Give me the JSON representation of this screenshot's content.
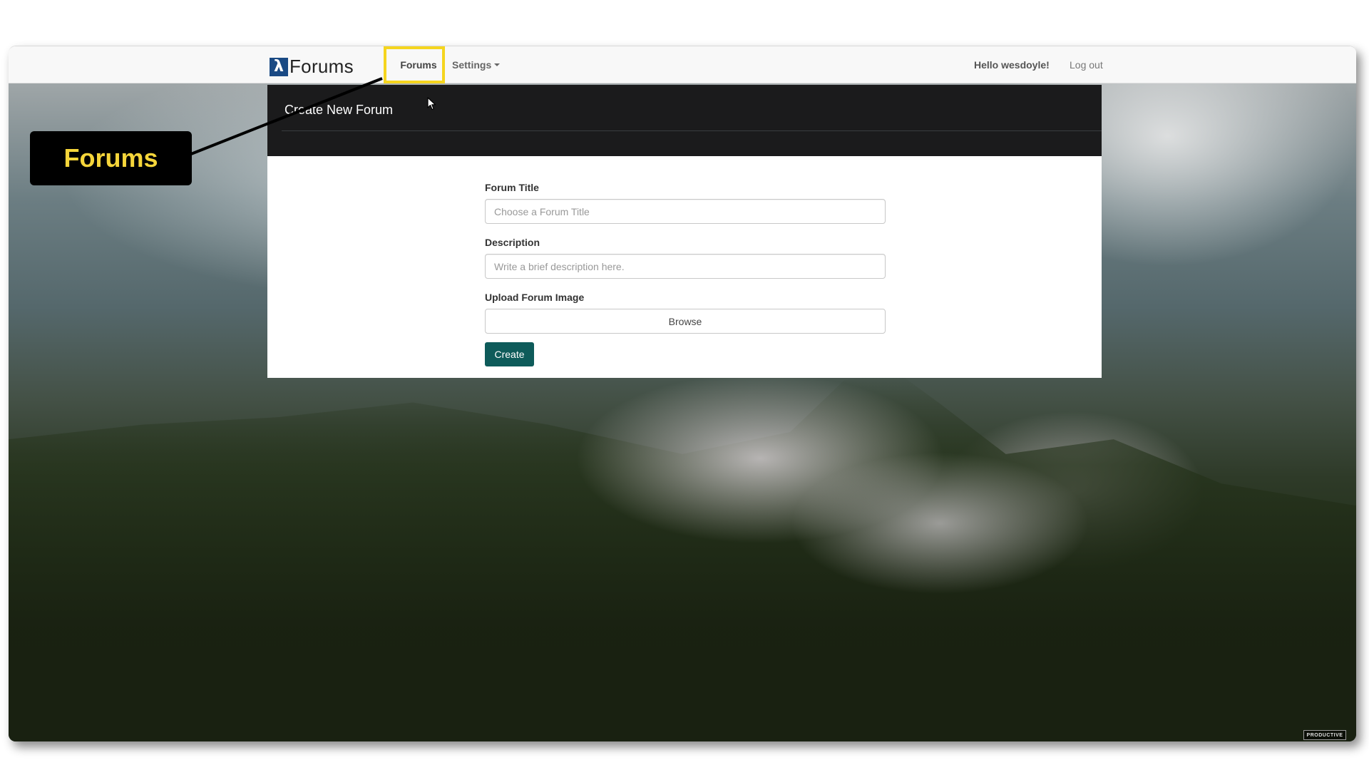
{
  "navbar": {
    "brand_symbol": "λ",
    "brand_text": "Forums",
    "forums_label": "Forums",
    "settings_label": "Settings",
    "greeting": "Hello wesdoyle!",
    "logout_label": "Log out"
  },
  "panel": {
    "title": "Create New Forum"
  },
  "form": {
    "title_label": "Forum Title",
    "title_placeholder": "Choose a Forum Title",
    "description_label": "Description",
    "description_placeholder": "Write a brief description here.",
    "image_label": "Upload Forum Image",
    "browse_label": "Browse",
    "create_label": "Create"
  },
  "callout": {
    "text": "Forums"
  },
  "watermark": "PRODUCTIVE",
  "colors": {
    "highlight": "#f5d51e",
    "callout_text": "#f5d53a",
    "create_button": "#0e5b5a",
    "brand_logo": "#1a4a84",
    "header_panel": "#1b1b1c"
  },
  "icons": {
    "brand": "lambda-icon",
    "settings_dropdown": "caret-down-icon",
    "cursor": "mouse-pointer-icon"
  }
}
